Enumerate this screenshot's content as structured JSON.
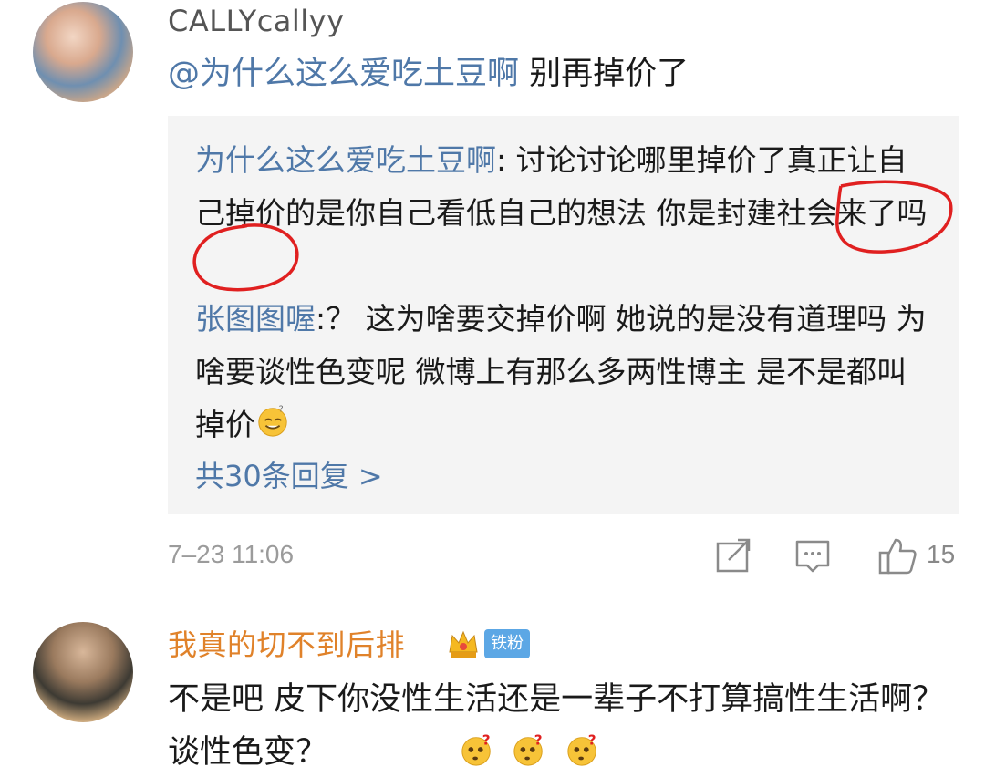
{
  "comments": [
    {
      "username": "CALLYcallyy",
      "mention": "@为什么这么爱吃土豆啊",
      "text": " 别再掉价了",
      "replies": [
        {
          "name": "为什么这么爱吃土豆啊",
          "text": ": 讨论讨论哪里掉价了真正让自己掉价的是你自己看低自己的想法 你是封建社会来了吗"
        },
        {
          "name": "张图图喔",
          "text": ":？ 这为啥要交掉价啊 她说的是没有道理吗 为啥要谈性色变呢 微博上有那么多两性博主 是不是都叫掉价"
        }
      ],
      "more_replies": "共30条回复 >",
      "time": "7–23 11:06",
      "likes": "15"
    },
    {
      "username": "我真的切不到后排",
      "fan_badge": "铁粉",
      "text": "不是吧 皮下你没性生活还是一辈子不打算搞性生活啊？ 谈性色变？"
    }
  ],
  "icons": {
    "share": "share-icon",
    "comment": "comment-icon",
    "like": "thumbs-up-icon",
    "crown": "crown-badge-icon",
    "emoji": "thinking-face-icon"
  },
  "colors": {
    "link": "#4f78a8",
    "username_vip": "#e0822a",
    "reply_bg": "#f4f4f4",
    "circle_mark": "#e02020"
  }
}
